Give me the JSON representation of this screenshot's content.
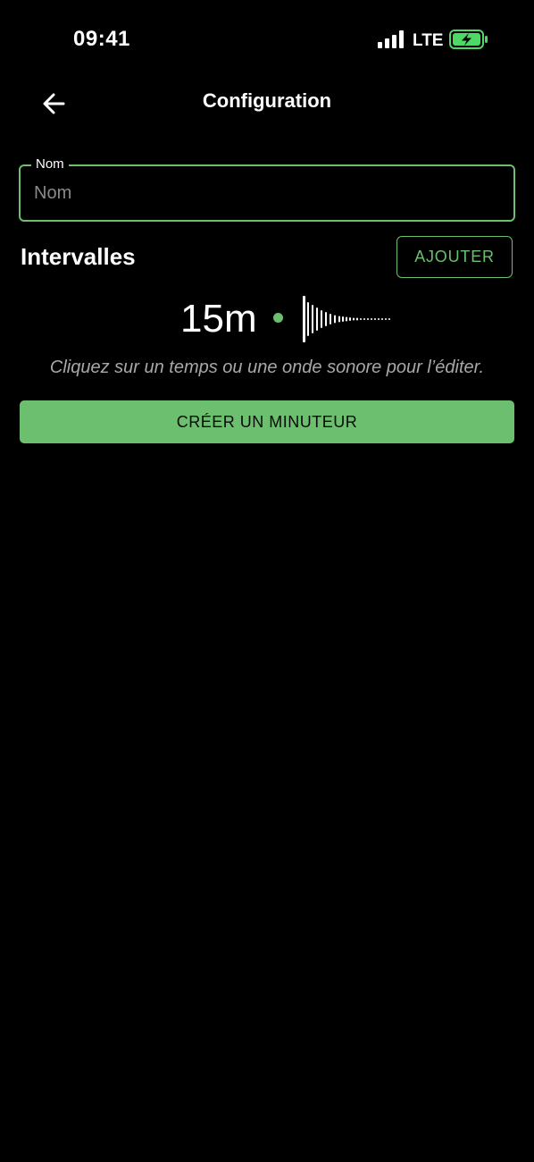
{
  "status_bar": {
    "time": "09:41",
    "network": "LTE",
    "signal_icon": "signal-bars-icon",
    "battery_icon": "battery-charging-icon",
    "battery_color": "#4cd964"
  },
  "header": {
    "back_icon": "arrow-left-icon",
    "title": "Configuration"
  },
  "name_field": {
    "label": "Nom",
    "placeholder": "Nom",
    "value": ""
  },
  "intervals": {
    "heading": "Intervalles",
    "add_label": "AJOUTER",
    "items": [
      {
        "time": "15m",
        "waveform_icon": "sound-wave-icon"
      }
    ],
    "hint": "Cliquez sur un temps ou une onde sonore pour l’éditer."
  },
  "create_label": "CRÉER UN MINUTEUR",
  "colors": {
    "accent": "#6bbf6e",
    "background": "#000000",
    "text": "#ffffff",
    "muted_text": "#a8a8a8"
  }
}
